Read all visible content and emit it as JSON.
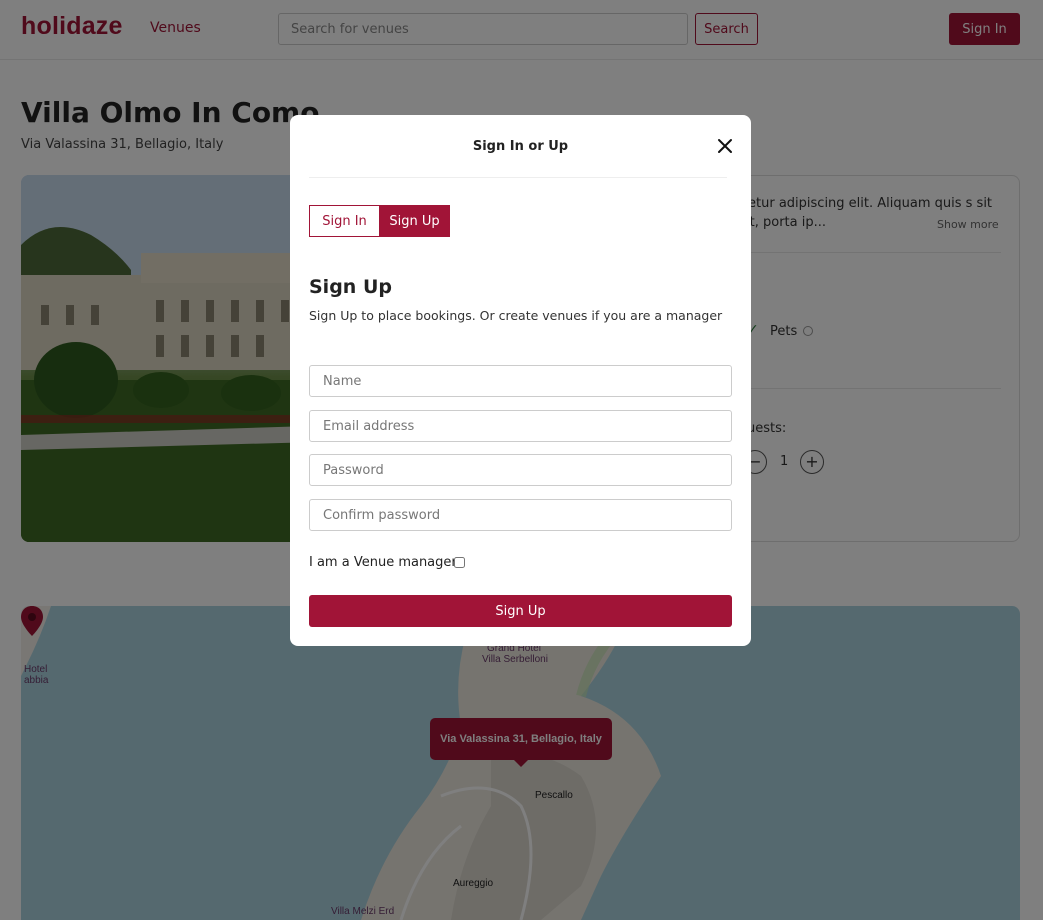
{
  "header": {
    "logo": "holidaze",
    "nav_venues": "Venues",
    "search_placeholder": "Search for venues",
    "search_button": "Search",
    "signin_button": "Sign In"
  },
  "venue": {
    "title": "Villa Olmo In Como",
    "address": "Via Valassina 31, Bellagio, Italy",
    "description": "sectetur adipiscing elit. Aliquam quis s sit amet, porta ip...",
    "show_more": "Show more",
    "amenity_pets": "Pets",
    "guests_label": "uests:",
    "guest_minus": "−",
    "guest_count": "1",
    "guest_plus": "+"
  },
  "map": {
    "tooltip": "Via Valassina 31, Bellagio, Italy",
    "labels": {
      "hotel_left_1": "Hotel",
      "hotel_left_2": "abbia",
      "grand_hotel_1": "Grand Hotel",
      "grand_hotel_2": "Villa Serbelloni",
      "pescallo": "Pescallo",
      "aureggio": "Aureggio",
      "villa_melzi": "Villa Melzi Erd"
    }
  },
  "modal": {
    "title": "Sign In or Up",
    "tab_signin": "Sign In",
    "tab_signup": "Sign Up",
    "heading": "Sign Up",
    "subtitle": "Sign Up to place bookings. Or create venues if you are a manager",
    "name_placeholder": "Name",
    "email_placeholder": "Email address",
    "password_placeholder": "Password",
    "confirm_placeholder": "Confirm password",
    "manager_label": "I am a Venue manager",
    "manager_checked": false,
    "submit": "Sign Up"
  },
  "colors": {
    "brand": "#a11437",
    "overlay": "rgba(0,0,0,0.5)"
  }
}
